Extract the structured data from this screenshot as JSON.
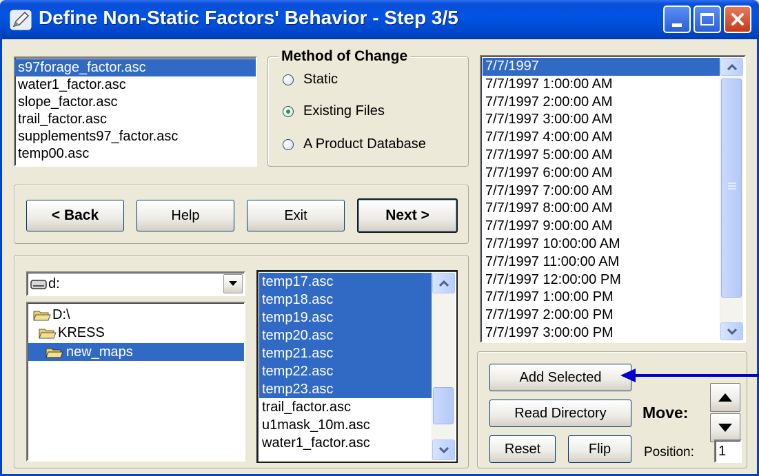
{
  "window": {
    "title": "Define Non-Static Factors' Behavior - Step 3/5"
  },
  "factors_list": [
    "s97forage_factor.asc",
    "water1_factor.asc",
    "slope_factor.asc",
    "trail_factor.asc",
    "supplements97_factor.asc",
    "temp00.asc"
  ],
  "method_of_change": {
    "legend": "Method of Change",
    "options": [
      "Static",
      "Existing Files",
      "A Product Database"
    ],
    "selected": "Existing Files"
  },
  "nav_buttons": {
    "back": "< Back",
    "help": "Help",
    "exit": "Exit",
    "next": "Next >"
  },
  "drive": {
    "value": "d:"
  },
  "directories": [
    "D:\\",
    "KRESS",
    "new_maps"
  ],
  "files": [
    "temp17.asc",
    "temp18.asc",
    "temp19.asc",
    "temp20.asc",
    "temp21.asc",
    "temp22.asc",
    "temp23.asc",
    "trail_factor.asc",
    "u1mask_10m.asc",
    "water1_factor.asc"
  ],
  "times": [
    "7/7/1997",
    "7/7/1997 1:00:00 AM",
    "7/7/1997 2:00:00 AM",
    "7/7/1997 3:00:00 AM",
    "7/7/1997 4:00:00 AM",
    "7/7/1997 5:00:00 AM",
    "7/7/1997 6:00:00 AM",
    "7/7/1997 7:00:00 AM",
    "7/7/1997 8:00:00 AM",
    "7/7/1997 9:00:00 AM",
    "7/7/1997 10:00:00 AM",
    "7/7/1997 11:00:00 AM",
    "7/7/1997 12:00:00 PM",
    "7/7/1997 1:00:00 PM",
    "7/7/1997 2:00:00 PM",
    "7/7/1997 3:00:00 PM"
  ],
  "actions": {
    "add_selected": "Add Selected",
    "read_directory": "Read Directory",
    "reset": "Reset",
    "flip": "Flip",
    "move_label": "Move:",
    "position_label": "Position:",
    "position_value": "1"
  },
  "colors": {
    "selection": "#316ac5",
    "title_bar": "#0054e3",
    "annotation_arrow": "#0000cc"
  }
}
